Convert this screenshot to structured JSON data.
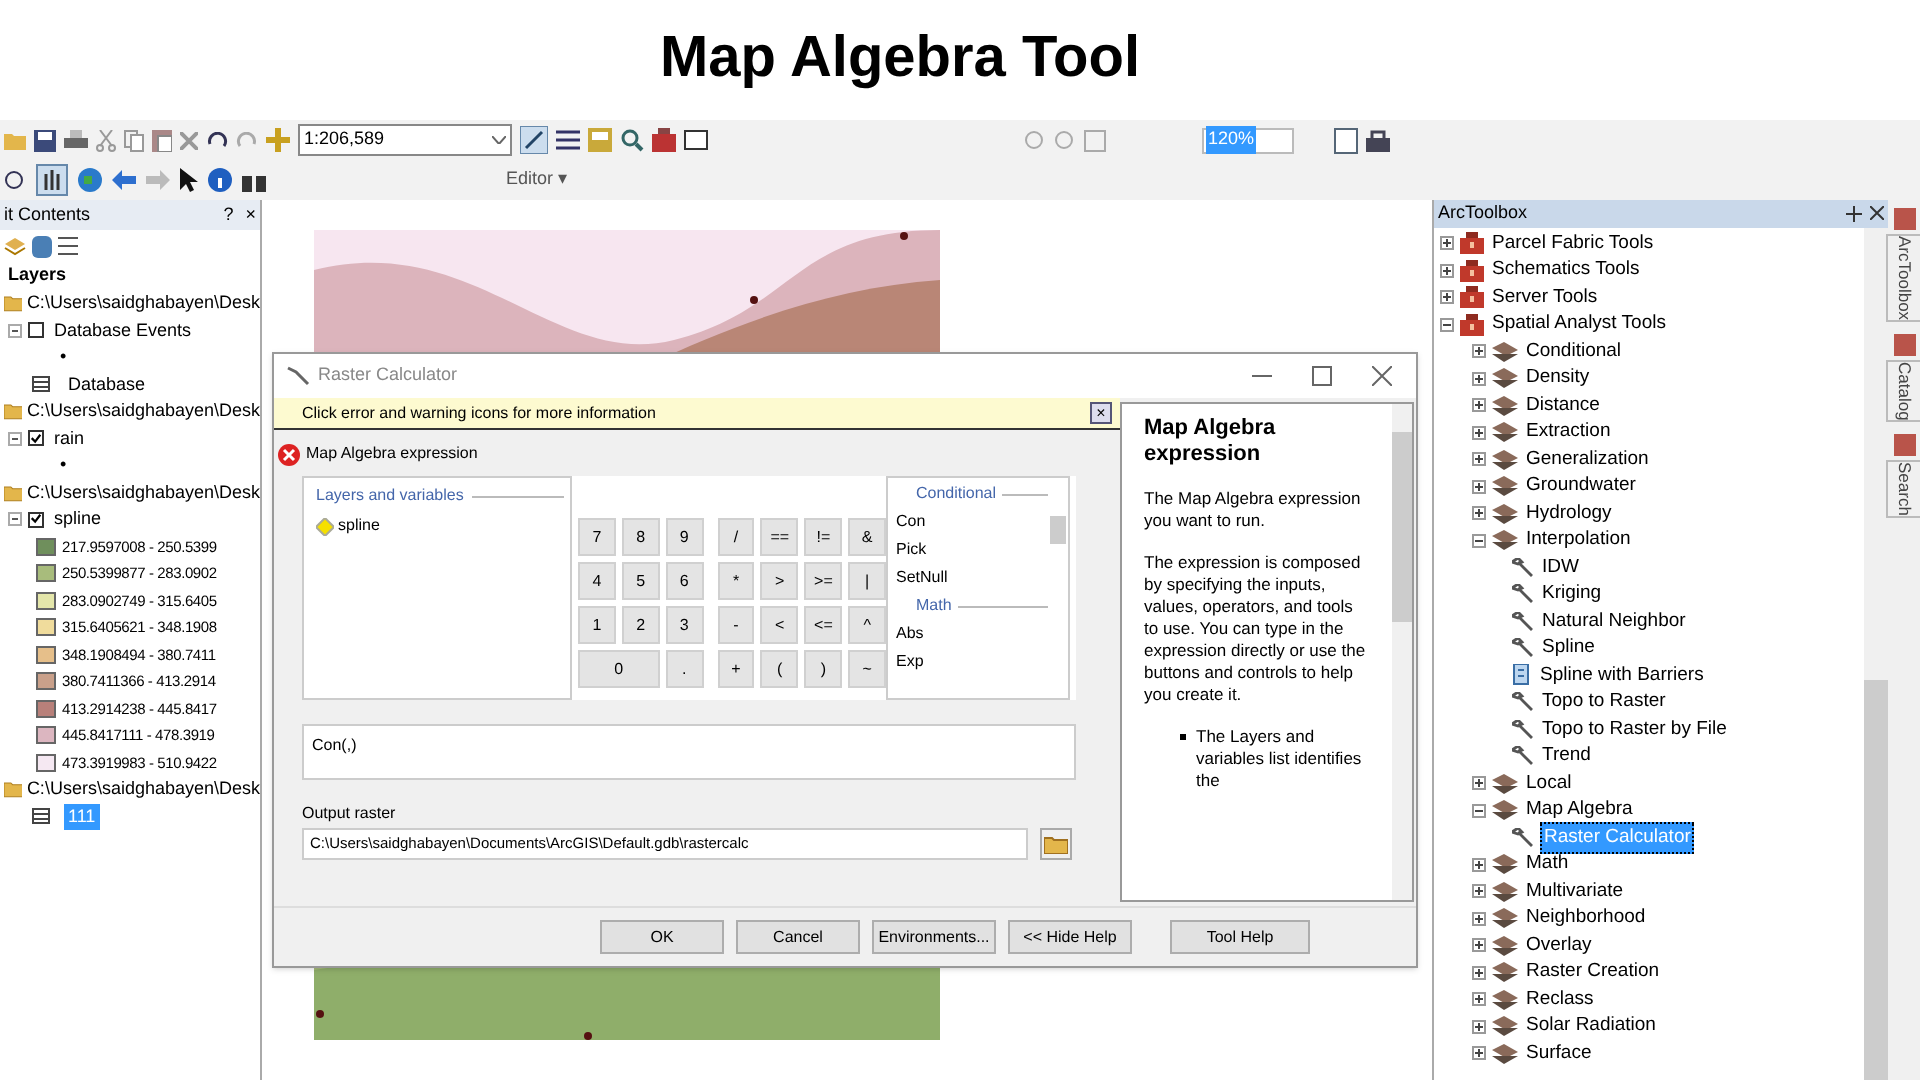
{
  "slide_title": "Map Algebra Tool",
  "toolbar": {
    "scale": "1:206,589",
    "zoom_percent": "120%",
    "editor_menu": "Editor ▾"
  },
  "table_of_contents": {
    "title": "it Contents",
    "help": "?",
    "close": "×",
    "root": "Layers",
    "groups": [
      {
        "path": "C:\\Users\\saidghabayen\\Desk",
        "layers": [
          {
            "kind": "check",
            "name": "Database Events",
            "checked": false
          },
          {
            "kind": "symbol",
            "name": "•"
          },
          {
            "kind": "table",
            "name": "Database",
            "selected": false
          }
        ]
      },
      {
        "path": "C:\\Users\\saidghabayen\\Desk",
        "layers": [
          {
            "kind": "check",
            "name": "rain",
            "checked": true
          },
          {
            "kind": "symbol",
            "name": "•"
          }
        ]
      },
      {
        "path": "C:\\Users\\saidghabayen\\Desk",
        "layers": [
          {
            "kind": "check",
            "name": "spline",
            "checked": true
          },
          {
            "kind": "legend",
            "name": "217.9597008 - 250.5399",
            "color": "#6f8f5c"
          },
          {
            "kind": "legend",
            "name": "250.5399877 - 283.0902",
            "color": "#a8bc7c"
          },
          {
            "kind": "legend",
            "name": "283.0902749 - 315.6405",
            "color": "#e4e6aa"
          },
          {
            "kind": "legend",
            "name": "315.6405621 - 348.1908",
            "color": "#f0dc9c"
          },
          {
            "kind": "legend",
            "name": "348.1908494 - 380.7411",
            "color": "#e6bf8a"
          },
          {
            "kind": "legend",
            "name": "380.7411366 - 413.2914",
            "color": "#c9a08a"
          },
          {
            "kind": "legend",
            "name": "413.2914238 - 445.8417",
            "color": "#b8807a"
          },
          {
            "kind": "legend",
            "name": "445.8417111 - 478.3919",
            "color": "#dcb6c0"
          },
          {
            "kind": "legend",
            "name": "473.3919983 - 510.9422",
            "color": "#f5e8f2"
          }
        ]
      },
      {
        "path": "C:\\Users\\saidghabayen\\Desk",
        "layers": [
          {
            "kind": "table",
            "name": "111",
            "selected": true
          }
        ]
      }
    ]
  },
  "dialog": {
    "title": "Raster Calculator",
    "notice": "Click error and warning icons for more information",
    "notice_close": "×",
    "expression_label": "Map Algebra expression",
    "layers_header": "Layers and variables",
    "layers": [
      "spline"
    ],
    "keys": [
      [
        "7",
        "8",
        "9",
        "/",
        "==",
        "!=",
        "&"
      ],
      [
        "4",
        "5",
        "6",
        "*",
        ">",
        ">=",
        "|"
      ],
      [
        "1",
        "2",
        "3",
        "-",
        "<",
        "<=",
        "^"
      ],
      [
        "0",
        ".",
        "+",
        "(",
        ")",
        "~"
      ]
    ],
    "functions": [
      {
        "kind": "header",
        "label": "Conditional"
      },
      {
        "kind": "item",
        "label": "Con"
      },
      {
        "kind": "item",
        "label": "Pick"
      },
      {
        "kind": "item",
        "label": "SetNull"
      },
      {
        "kind": "header",
        "label": "Math"
      },
      {
        "kind": "item",
        "label": "Abs"
      },
      {
        "kind": "item",
        "label": "Exp"
      }
    ],
    "expression": "Con(,)",
    "output_label": "Output raster",
    "output_value": "C:\\Users\\saidghabayen\\Documents\\ArcGIS\\Default.gdb\\rastercalc",
    "buttons": [
      "OK",
      "Cancel",
      "Environments...",
      "<< Hide Help",
      "Tool Help"
    ],
    "help": {
      "heading": "Map Algebra expression",
      "paragraphs": [
        "The Map Algebra expression you want to run.",
        "The expression is composed by specifying the inputs, values, operators, and tools to use. You can type in the expression directly or use the buttons and controls to help you create it."
      ],
      "bullets": [
        "The Layers and variables list identifies the"
      ]
    }
  },
  "toolbox": {
    "title": "ArcToolbox",
    "items": [
      {
        "kind": "toolbox",
        "label": "Parcel Fabric Tools",
        "expanded": false
      },
      {
        "kind": "toolbox",
        "label": "Schematics Tools",
        "expanded": false
      },
      {
        "kind": "toolbox",
        "label": "Server Tools",
        "expanded": false
      },
      {
        "kind": "toolbox",
        "label": "Spatial Analyst Tools",
        "expanded": true,
        "children": [
          {
            "kind": "toolset",
            "label": "Conditional",
            "expanded": false
          },
          {
            "kind": "toolset",
            "label": "Density",
            "expanded": false
          },
          {
            "kind": "toolset",
            "label": "Distance",
            "expanded": false
          },
          {
            "kind": "toolset",
            "label": "Extraction",
            "expanded": false
          },
          {
            "kind": "toolset",
            "label": "Generalization",
            "expanded": false
          },
          {
            "kind": "toolset",
            "label": "Groundwater",
            "expanded": false
          },
          {
            "kind": "toolset",
            "label": "Hydrology",
            "expanded": false
          },
          {
            "kind": "toolset",
            "label": "Interpolation",
            "expanded": true,
            "children": [
              {
                "kind": "tool",
                "label": "IDW",
                "selected": false
              },
              {
                "kind": "tool",
                "label": "Kriging",
                "selected": false
              },
              {
                "kind": "tool",
                "label": "Natural Neighbor",
                "selected": false
              },
              {
                "kind": "tool",
                "label": "Spline",
                "selected": false
              },
              {
                "kind": "script",
                "label": "Spline with Barriers",
                "selected": false
              },
              {
                "kind": "tool",
                "label": "Topo to Raster",
                "selected": false
              },
              {
                "kind": "tool",
                "label": "Topo to Raster by File",
                "selected": false
              },
              {
                "kind": "tool",
                "label": "Trend",
                "selected": false
              }
            ]
          },
          {
            "kind": "toolset",
            "label": "Local",
            "expanded": false
          },
          {
            "kind": "toolset",
            "label": "Map Algebra",
            "expanded": true,
            "children": [
              {
                "kind": "tool",
                "label": "Raster Calculator",
                "selected": true
              }
            ]
          },
          {
            "kind": "toolset",
            "label": "Math",
            "expanded": false
          },
          {
            "kind": "toolset",
            "label": "Multivariate",
            "expanded": false
          },
          {
            "kind": "toolset",
            "label": "Neighborhood",
            "expanded": false
          },
          {
            "kind": "toolset",
            "label": "Overlay",
            "expanded": false
          },
          {
            "kind": "toolset",
            "label": "Raster Creation",
            "expanded": false
          },
          {
            "kind": "toolset",
            "label": "Reclass",
            "expanded": false
          },
          {
            "kind": "toolset",
            "label": "Solar Radiation",
            "expanded": false
          },
          {
            "kind": "toolset",
            "label": "Surface",
            "expanded": false
          }
        ]
      }
    ]
  },
  "side_tabs": [
    "ArcToolbox",
    "Catalog",
    "Search"
  ]
}
